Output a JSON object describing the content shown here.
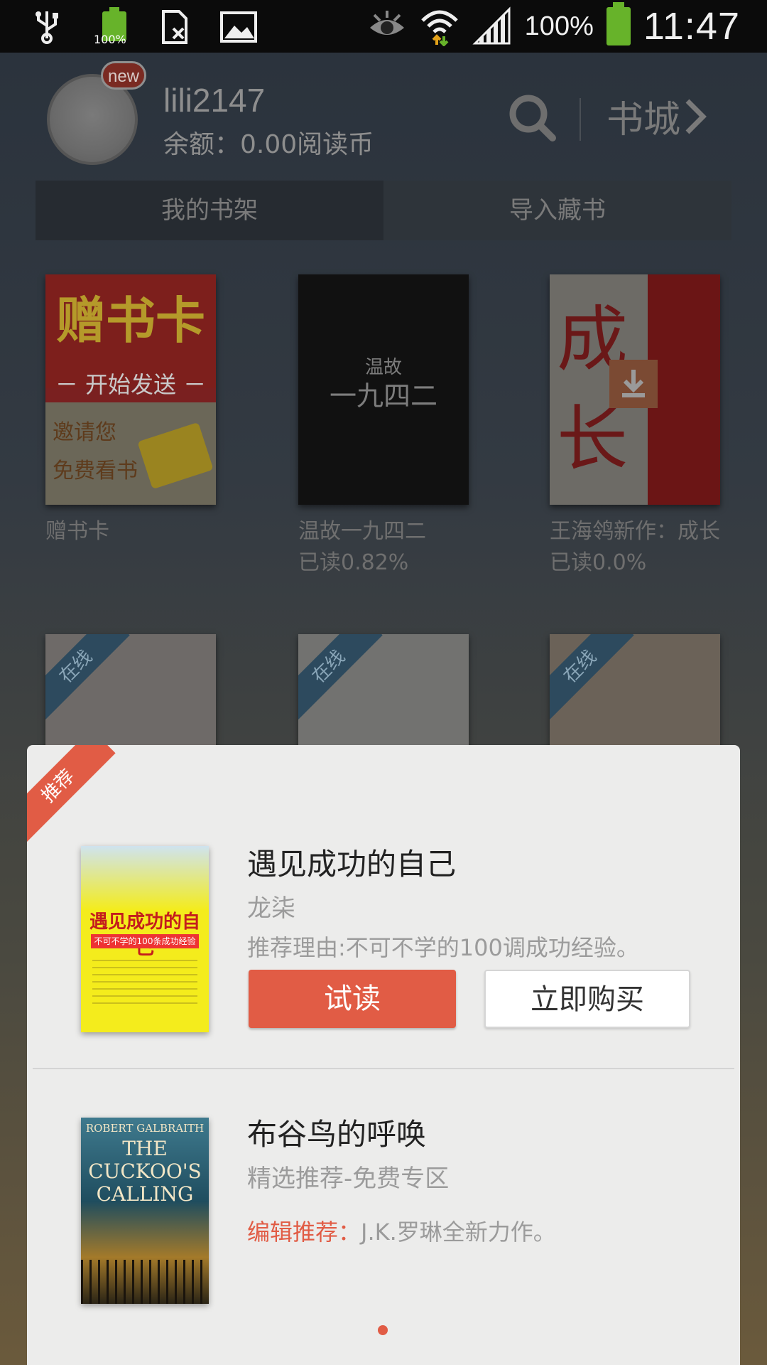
{
  "status_bar": {
    "battery_small_label": "100%",
    "battery_percent": "100%",
    "time": "11:47"
  },
  "header": {
    "badge": "new",
    "username": "lili2147",
    "balance": "余额：0.00阅读币",
    "store_label": "书城"
  },
  "tabs": [
    {
      "label": "我的书架"
    },
    {
      "label": "导入藏书"
    }
  ],
  "shelf": [
    {
      "title": "赠书卡",
      "cover": {
        "top": "赠书卡",
        "mid": "－ 开始发送 －",
        "line1": "邀请您",
        "line2": "免费看书"
      }
    },
    {
      "title": "温故一九四二",
      "progress": "已读0.82%",
      "cover": {
        "t1": "温故",
        "t2": "一九四二"
      }
    },
    {
      "title": "王海鸰新作：成长",
      "progress": "已读0.0%",
      "cover": {
        "t1": "成",
        "t2": "长"
      }
    },
    {
      "ribbon": "在线"
    },
    {
      "ribbon": "在线"
    },
    {
      "ribbon": "在线"
    }
  ],
  "recommend": {
    "ribbon": "推荐",
    "items": [
      {
        "title": "遇见成功的自己",
        "author": "龙柒",
        "reason": "推荐理由:不可不学的100调成功经验。",
        "try_label": "试读",
        "buy_label": "立即购买",
        "cover": {
          "title": "遇见成功的自己",
          "sub": "不可不学的100条成功经验"
        }
      },
      {
        "title": "布谷鸟的呼唤",
        "author": "精选推荐-免费专区",
        "reason_label": "编辑推荐：",
        "reason": "J.K.罗琳全新力作。",
        "cover": {
          "author": "ROBERT GALBRAITH",
          "title": "THE CUCKOO'S CALLING"
        }
      }
    ]
  },
  "colors": {
    "accent": "#e15c45",
    "battery": "#67b32a"
  }
}
